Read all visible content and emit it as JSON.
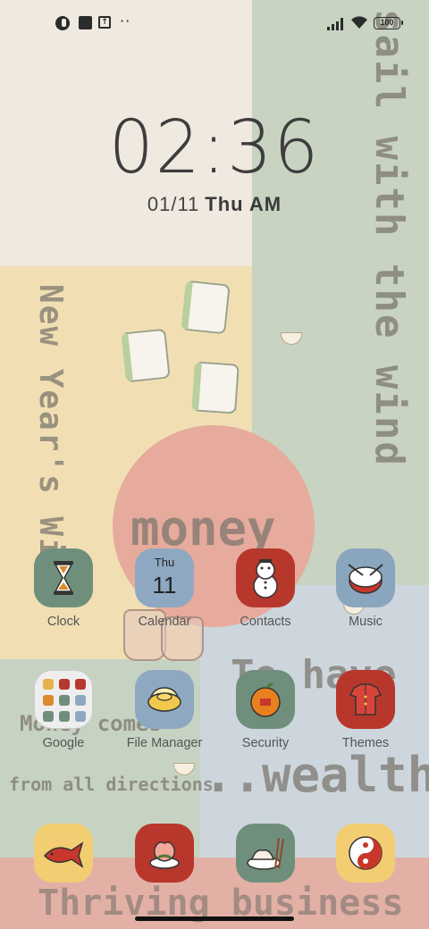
{
  "status_bar": {
    "battery": "100",
    "icons": [
      "mi-icon",
      "square-icon",
      "upload-icon",
      "more-dots-icon",
      "signal-icon",
      "wifi-icon",
      "battery-icon"
    ]
  },
  "lockclock": {
    "time": "02:36",
    "date": "01/11",
    "day": "Thu AM"
  },
  "wallpaper_text": {
    "sail": "sail with the wind",
    "new_year": "New Year's Wish",
    "money": "money",
    "to_have": "To have",
    "money_comes": "Money comes",
    "directions": "from all directions",
    "wealth": "..wealth",
    "thriving": "Thriving business"
  },
  "apps": {
    "row1": [
      {
        "label": "Clock",
        "icon": "hourglass-icon"
      },
      {
        "label": "Calendar",
        "icon": "calendar-icon",
        "day": "Thu",
        "date": "11"
      },
      {
        "label": "Contacts",
        "icon": "snowman-icon"
      },
      {
        "label": "Music",
        "icon": "drum-icon"
      }
    ],
    "row2": [
      {
        "label": "Google",
        "icon": "google-folder-icon"
      },
      {
        "label": "File Manager",
        "icon": "gold-ingot-icon"
      },
      {
        "label": "Security",
        "icon": "orange-icon"
      },
      {
        "label": "Themes",
        "icon": "red-shirt-icon"
      }
    ],
    "dock": [
      {
        "icon": "koi-fish-icon"
      },
      {
        "icon": "peach-icon"
      },
      {
        "icon": "dumpling-icon"
      },
      {
        "icon": "yin-yang-icon"
      }
    ]
  },
  "colors": {
    "accent_red": "#b8372c",
    "accent_green": "#6f8f7c",
    "accent_blue": "#8fa8c2",
    "accent_yellow": "#f3cd72"
  }
}
